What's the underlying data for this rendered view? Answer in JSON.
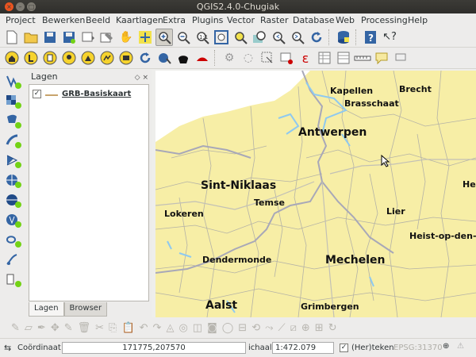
{
  "window": {
    "title": "QGIS2.4.0-Chugiak"
  },
  "menubar": {
    "items": [
      {
        "label": "Project"
      },
      {
        "label": "Bewerken"
      },
      {
        "label": "Beeld"
      },
      {
        "label": "Kaartlagen"
      },
      {
        "label": "Extra"
      },
      {
        "label": "Plugins"
      },
      {
        "label": "Vector"
      },
      {
        "label": "Raster"
      },
      {
        "label": "Database"
      },
      {
        "label": "Web"
      },
      {
        "label": "Processing"
      },
      {
        "label": "Help"
      }
    ]
  },
  "toolbar1": {
    "icons": [
      "new-project-icon",
      "open-project-icon",
      "save-project-icon",
      "save-as-icon",
      "print-composer-icon",
      "composer-manager-icon",
      "pan-icon",
      "pan-to-selection-icon",
      "zoom-in-icon",
      "zoom-out-icon",
      "zoom-actual-icon",
      "zoom-full-icon",
      "zoom-to-selection-icon",
      "zoom-to-layer-icon",
      "zoom-last-icon",
      "zoom-next-icon",
      "refresh-icon",
      "db-manager-icon",
      "help-contents-icon",
      "whats-this-icon"
    ]
  },
  "toolbar2": {
    "icons": [
      "home-icon",
      "label-icon",
      "note-icon",
      "pin-icon",
      "highlight-icon",
      "change-label-icon",
      "show-hide-labels-icon",
      "rotate-label-icon",
      "identify-icon",
      "map-tips-icon",
      "measure-icon",
      "select-icon",
      "deselect-icon",
      "expression-icon",
      "attribute-table-icon",
      "field-calculator-icon",
      "measure-line-icon",
      "annotation-icon"
    ]
  },
  "left_toolbar": {
    "icons": [
      "add-vector-layer-icon",
      "add-raster-layer-icon",
      "add-postgis-layer-icon",
      "add-spatialite-layer-icon",
      "add-mssql-layer-icon",
      "add-wms-layer-icon",
      "add-wcs-layer-icon",
      "add-wfs-layer-icon",
      "add-delimited-text-icon",
      "new-shapefile-icon",
      "add-gpx-icon"
    ]
  },
  "layers_panel": {
    "title": "Lagen",
    "float_btn": "◇",
    "close_btn": "×",
    "layers": [
      {
        "name": "GRB-Basiskaart",
        "checked": "✓"
      }
    ],
    "tabs": [
      {
        "label": "Lagen"
      },
      {
        "label": "Browser"
      }
    ]
  },
  "map": {
    "places": [
      {
        "name": "Kapellen"
      },
      {
        "name": "Brecht"
      },
      {
        "name": "Brasschaat"
      },
      {
        "name": "Antwerpen"
      },
      {
        "name": "Sint-Niklaas"
      },
      {
        "name": "He"
      },
      {
        "name": "Temse"
      },
      {
        "name": "Lokeren"
      },
      {
        "name": "Lier"
      },
      {
        "name": "Heist-op-den-"
      },
      {
        "name": "Dendermonde"
      },
      {
        "name": "Mechelen"
      },
      {
        "name": "Aalst"
      },
      {
        "name": "Grimbergen"
      }
    ]
  },
  "statusbar": {
    "coord_label": "Coördinaat",
    "coord_value": "171775,207570",
    "scale_label": "ichaal",
    "scale_value": "1:472.079",
    "render_label": "(Her)teken",
    "epsg": "EPSG:31370",
    "render_checked": "✓"
  },
  "colors": {
    "land": "#f7eea6",
    "water": "#8ec9f0",
    "river": "#a8a8b8",
    "sea": "#ffffff"
  }
}
